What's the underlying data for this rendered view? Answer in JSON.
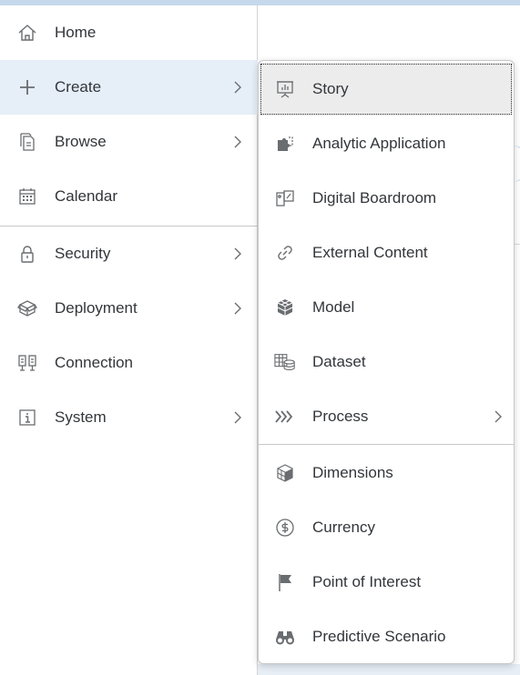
{
  "colors": {
    "text": "#32363a",
    "icon": "#6a6d70",
    "active_bg": "#e6eef8",
    "focus_bg": "#ececec",
    "separator": "#c8c8c8"
  },
  "nav": {
    "items": [
      {
        "label": "Home",
        "icon": "home-icon"
      },
      {
        "label": "Create",
        "icon": "plus-icon",
        "has_submenu": true,
        "active": true
      },
      {
        "label": "Browse",
        "icon": "browse-files-icon",
        "has_submenu": true
      },
      {
        "label": "Calendar",
        "icon": "calendar-icon"
      },
      {
        "label": "Security",
        "icon": "lock-icon",
        "has_submenu": true
      },
      {
        "label": "Deployment",
        "icon": "deployment-package-icon",
        "has_submenu": true
      },
      {
        "label": "Connection",
        "icon": "connection-icon"
      },
      {
        "label": "System",
        "icon": "info-icon",
        "has_submenu": true
      }
    ]
  },
  "submenu": {
    "items": [
      {
        "label": "Story",
        "icon": "presentation-story-icon",
        "focused": true
      },
      {
        "label": "Analytic Application",
        "icon": "puzzle-icon"
      },
      {
        "label": "Digital Boardroom",
        "icon": "boardroom-icon"
      },
      {
        "label": "External Content",
        "icon": "link-icon"
      },
      {
        "label": "Model",
        "icon": "cube-model-icon"
      },
      {
        "label": "Dataset",
        "icon": "dataset-icon"
      },
      {
        "label": "Process",
        "icon": "process-chevrons-icon",
        "has_submenu": true
      },
      {
        "label": "Dimensions",
        "icon": "dimensions-cube-icon"
      },
      {
        "label": "Currency",
        "icon": "currency-icon"
      },
      {
        "label": "Point of Interest",
        "icon": "flag-icon"
      },
      {
        "label": "Predictive Scenario",
        "icon": "binoculars-icon"
      }
    ]
  }
}
